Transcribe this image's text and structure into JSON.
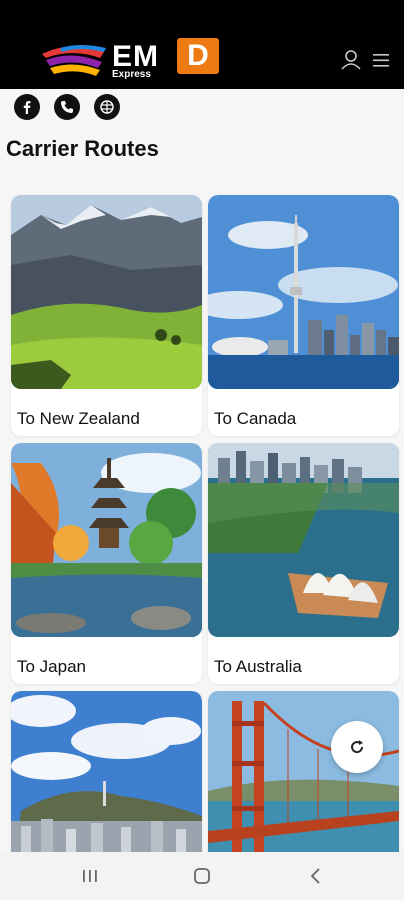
{
  "header": {
    "brand_main": "EM",
    "brand_letter": "D",
    "brand_sub": "Express",
    "icons": [
      "user-icon",
      "menu-icon"
    ]
  },
  "contact": {
    "icons": [
      "facebook-icon",
      "phone-icon",
      "website-icon"
    ]
  },
  "page": {
    "title": "Carrier Routes"
  },
  "routes": [
    {
      "label": "To New Zealand",
      "image": "mountains-valley"
    },
    {
      "label": "To Canada",
      "image": "toronto-skyline"
    },
    {
      "label": "To Japan",
      "image": "pagoda-garden"
    },
    {
      "label": "To Australia",
      "image": "sydney-opera-house"
    },
    {
      "label": "",
      "image": "seoul-city"
    },
    {
      "label": "",
      "image": "golden-gate-bridge"
    }
  ],
  "fab": {
    "icon": "refresh-icon"
  },
  "system_nav": {
    "icons": [
      "recent-apps-icon",
      "home-icon",
      "back-icon"
    ]
  },
  "colors": {
    "accent": "#ee7a14",
    "header_bg": "#000000"
  }
}
